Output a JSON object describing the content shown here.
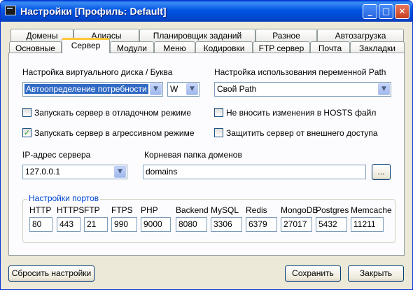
{
  "window": {
    "title": "Настройки [Профиль: Default]"
  },
  "titlebar_buttons": {
    "minimize": "_",
    "maximize": "□",
    "close": "✕"
  },
  "tabs_row1": [
    "Домены",
    "Алиасы",
    "Планировщик заданий",
    "Разное",
    "Автозагрузка"
  ],
  "tabs_row2": [
    "Основные",
    "Сервер",
    "Модули",
    "Меню",
    "Кодировки",
    "FTP сервер",
    "Почта",
    "Закладки"
  ],
  "active_tab": "Сервер",
  "server": {
    "vdisk_label": "Настройка виртуального диска / Буква",
    "vdisk_mode": "Автоопределение потребности",
    "vdisk_letter": "W",
    "path_label": "Настройка использования переменной Path",
    "path_value": "Свой Path",
    "debug_mode": {
      "label": "Запускать сервер в отладочном режиме",
      "checked": false
    },
    "aggressive_mode": {
      "label": "Запускать сервер в агрессивном режиме",
      "checked": true
    },
    "no_hosts": {
      "label": "Не вносить изменения в HOSTS файл",
      "checked": false
    },
    "protect": {
      "label": "Защитить сервер от внешнего доступа",
      "checked": false
    },
    "ip_label": "IP-адрес сервера",
    "ip_value": "127.0.0.1",
    "root_label": "Корневая папка доменов",
    "root_value": "domains",
    "browse_label": "...",
    "ports_title": "Настройки портов",
    "ports": [
      {
        "name": "HTTP",
        "value": "80"
      },
      {
        "name": "HTTPS",
        "value": "443"
      },
      {
        "name": "FTP",
        "value": "21"
      },
      {
        "name": "FTPS",
        "value": "990"
      },
      {
        "name": "PHP",
        "value": "9000"
      },
      {
        "name": "Backend",
        "value": "8080"
      },
      {
        "name": "MySQL",
        "value": "3306"
      },
      {
        "name": "Redis",
        "value": "6379"
      },
      {
        "name": "MongoDB",
        "value": "27017"
      },
      {
        "name": "Postgres",
        "value": "5432"
      },
      {
        "name": "Memcache",
        "value": "11211"
      }
    ]
  },
  "footer": {
    "reset": "Сбросить настройки",
    "save": "Сохранить",
    "close": "Закрыть"
  },
  "icons": {
    "checkmark": "✓",
    "dropdown": "▼"
  },
  "colors": {
    "title_bar": "#0054e3",
    "active_tab_accent": "#ffc83c",
    "group_title": "#0046d5",
    "check": "#21a121"
  }
}
